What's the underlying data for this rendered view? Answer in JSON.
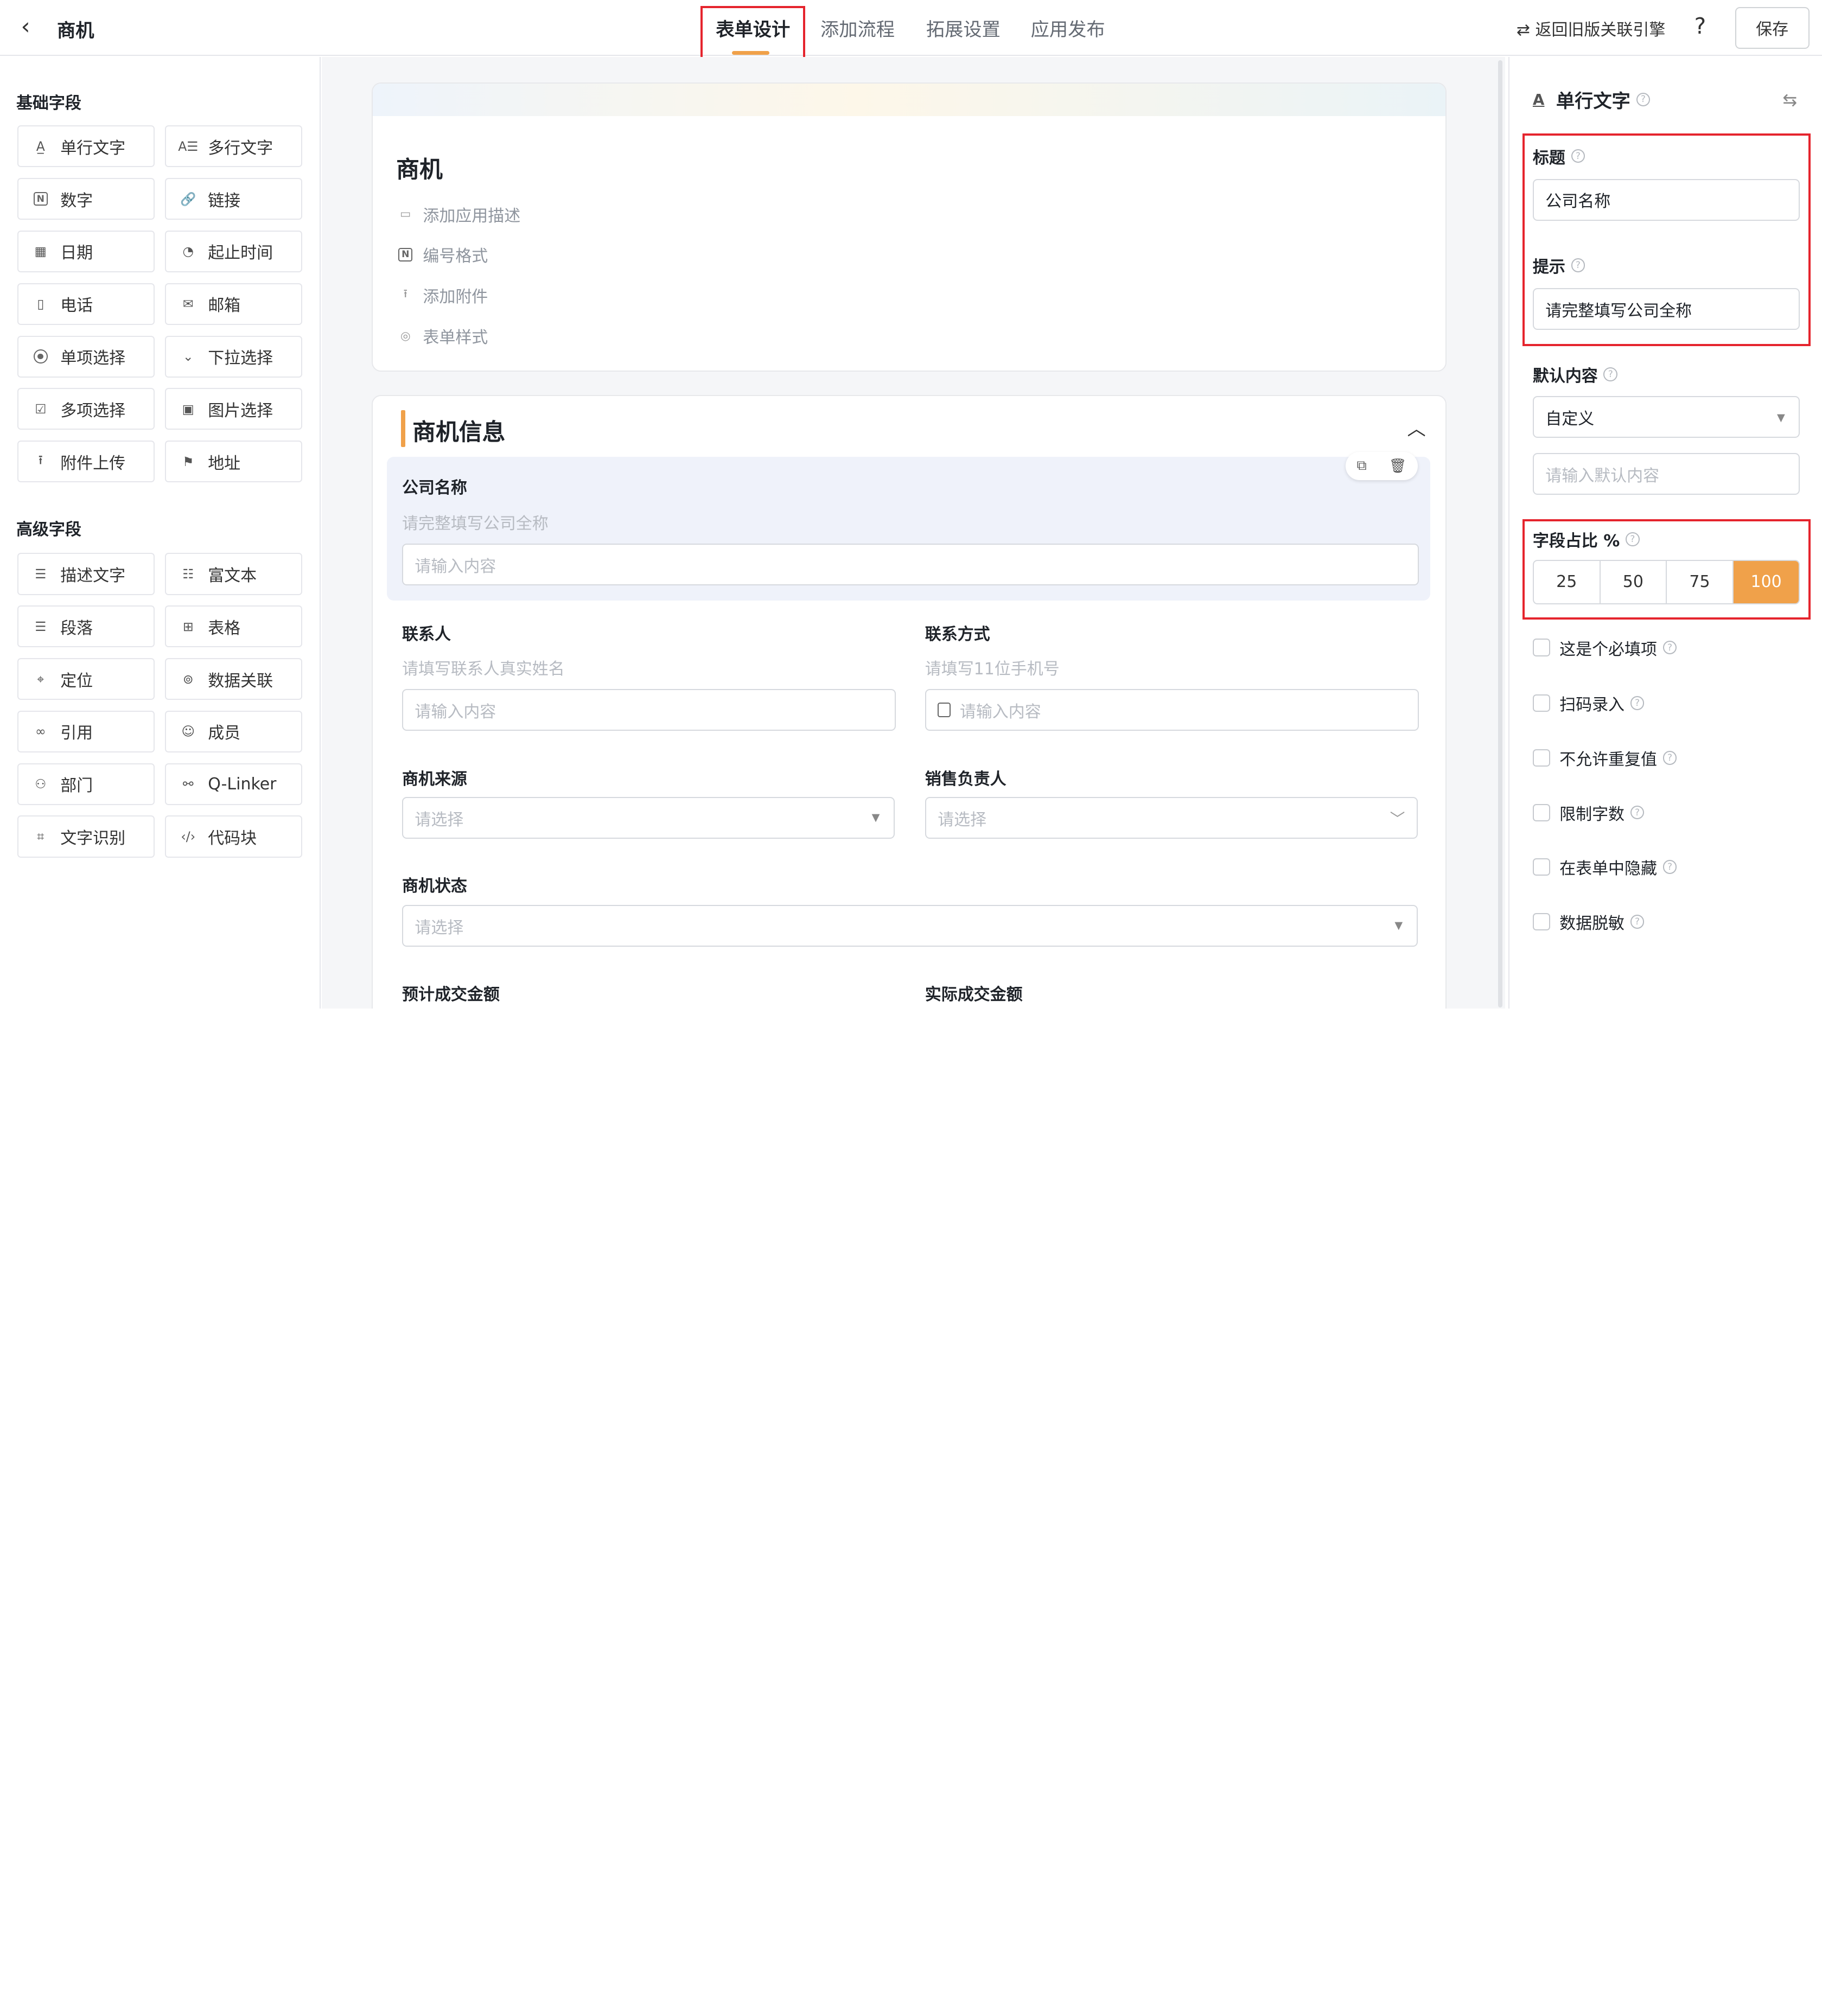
{
  "header": {
    "back_glyph": "‹",
    "app_title": "商机",
    "tabs": [
      "表单设计",
      "添加流程",
      "拓展设置",
      "应用发布"
    ],
    "active_tab": "表单设计",
    "return_link": "⇄ 返回旧版关联引擎",
    "help_glyph": "?",
    "save_label": "保存",
    "accent_color": "#f0a14a"
  },
  "left": {
    "basic_title": "基础字段",
    "basic_fields": [
      {
        "label": "单行文字",
        "icon": "single-line-text-icon"
      },
      {
        "label": "多行文字",
        "icon": "multi-line-text-icon"
      },
      {
        "label": "数字",
        "icon": "number-icon"
      },
      {
        "label": "链接",
        "icon": "link-icon"
      },
      {
        "label": "日期",
        "icon": "calendar-icon"
      },
      {
        "label": "起止时间",
        "icon": "time-range-icon"
      },
      {
        "label": "电话",
        "icon": "phone-icon"
      },
      {
        "label": "邮箱",
        "icon": "mail-icon"
      },
      {
        "label": "单项选择",
        "icon": "radio-icon"
      },
      {
        "label": "下拉选择",
        "icon": "dropdown-icon"
      },
      {
        "label": "多项选择",
        "icon": "checkbox-icon"
      },
      {
        "label": "图片选择",
        "icon": "image-icon"
      },
      {
        "label": "附件上传",
        "icon": "upload-icon"
      },
      {
        "label": "地址",
        "icon": "address-icon"
      }
    ],
    "advanced_title": "高级字段",
    "advanced_fields": [
      {
        "label": "描述文字",
        "icon": "description-icon"
      },
      {
        "label": "富文本",
        "icon": "rich-text-icon"
      },
      {
        "label": "段落",
        "icon": "paragraph-icon"
      },
      {
        "label": "表格",
        "icon": "table-icon"
      },
      {
        "label": "定位",
        "icon": "location-icon"
      },
      {
        "label": "数据关联",
        "icon": "data-link-icon"
      },
      {
        "label": "引用",
        "icon": "reference-icon"
      },
      {
        "label": "成员",
        "icon": "member-icon"
      },
      {
        "label": "部门",
        "icon": "department-icon"
      },
      {
        "label": "Q-Linker",
        "icon": "q-linker-icon"
      },
      {
        "label": "文字识别",
        "icon": "ocr-icon"
      },
      {
        "label": "代码块",
        "icon": "code-icon"
      }
    ]
  },
  "form": {
    "title": "商机",
    "meta": [
      "添加应用描述",
      "编号格式",
      "添加附件",
      "表单样式"
    ],
    "section_title": "商机信息",
    "fields": {
      "company_label": "公司名称",
      "company_hint": "请完整填写公司全称",
      "company_placeholder": "请输入内容",
      "contact_label": "联系人",
      "contact_hint": "请填写联系人真实姓名",
      "contact_placeholder": "请输入内容",
      "phone_label": "联系方式",
      "phone_hint": "请填写11位手机号",
      "phone_placeholder": "请输入内容",
      "source_label": "商机来源",
      "source_placeholder": "请选择",
      "owner_label": "销售负责人",
      "owner_placeholder": "请选择",
      "status_label": "商机状态",
      "status_placeholder": "请选择",
      "expected_label": "预计成交金额",
      "actual_label": "实际成交金额"
    }
  },
  "props": {
    "type_label": "单行文字",
    "title_label": "标题",
    "title_value": "公司名称",
    "hint_label": "提示",
    "hint_value": "请完整填写公司全称",
    "default_label": "默认内容",
    "default_mode": "自定义",
    "default_placeholder": "请输入默认内容",
    "width_label": "字段占比 %",
    "width_options": [
      "25",
      "50",
      "75",
      "100"
    ],
    "width_selected": "100",
    "checkboxes": [
      {
        "label": "这是个必填项",
        "checked": false
      },
      {
        "label": "扫码录入",
        "checked": false
      },
      {
        "label": "不允许重复值",
        "checked": false
      },
      {
        "label": "限制字数",
        "checked": false
      },
      {
        "label": "在表单中隐藏",
        "checked": false
      },
      {
        "label": "数据脱敏",
        "checked": false
      }
    ]
  }
}
